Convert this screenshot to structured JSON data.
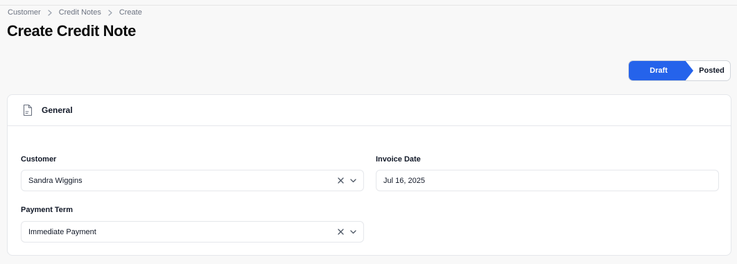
{
  "breadcrumb": {
    "items": [
      "Customer",
      "Credit Notes",
      "Create"
    ]
  },
  "page": {
    "title": "Create Credit Note"
  },
  "status": {
    "steps": [
      {
        "label": "Draft",
        "active": true
      },
      {
        "label": "Posted",
        "active": false
      }
    ],
    "active_color": "#2563eb"
  },
  "section": {
    "title": "General",
    "icon": "document-icon"
  },
  "form": {
    "customer": {
      "label": "Customer",
      "value": "Sandra Wiggins"
    },
    "invoice_date": {
      "label": "Invoice Date",
      "value": "Jul 16, 2025"
    },
    "payment_term": {
      "label": "Payment Term",
      "value": "Immediate Payment"
    }
  }
}
